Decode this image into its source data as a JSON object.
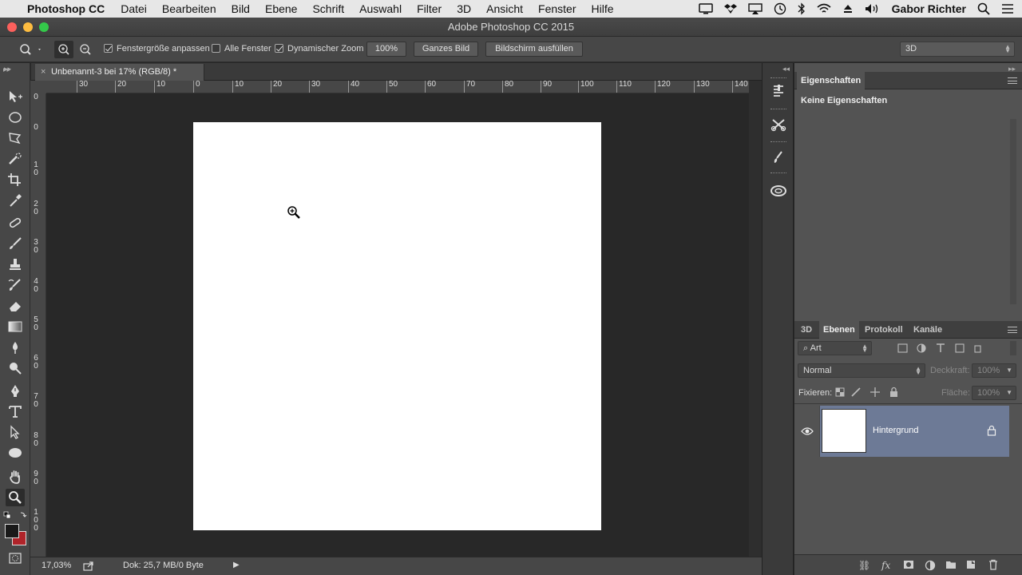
{
  "menubar": {
    "app_name": "Photoshop CC",
    "items": [
      "Datei",
      "Bearbeiten",
      "Bild",
      "Ebene",
      "Schrift",
      "Auswahl",
      "Filter",
      "3D",
      "Ansicht",
      "Fenster",
      "Hilfe"
    ],
    "user": "Gabor Richter",
    "status_icons": [
      "monitor-icon",
      "dropbox-icon",
      "airplay-icon",
      "time-machine-icon",
      "bluetooth-icon",
      "wifi-icon",
      "eject-icon",
      "volume-icon"
    ]
  },
  "window": {
    "title": "Adobe Photoshop CC 2015"
  },
  "options": {
    "fit_window": {
      "label": "Fenstergröße anpassen",
      "checked": true
    },
    "all_windows": {
      "label": "Alle Fenster",
      "checked": false
    },
    "scrubby_zoom": {
      "label": "Dynamischer Zoom",
      "checked": true
    },
    "btn_100": "100%",
    "btn_fit": "Ganzes Bild",
    "btn_fill": "Bildschirm ausfüllen",
    "workspace": "3D"
  },
  "document": {
    "tab_title": "Unbenannt-3 bei 17% (RGB/8) *",
    "close": "×",
    "h_ruler": [
      "30",
      "20",
      "10",
      "0",
      "10",
      "20",
      "30",
      "40",
      "50",
      "60",
      "70",
      "80",
      "90",
      "100",
      "110",
      "120",
      "130",
      "140"
    ],
    "v_ruler": [
      [
        "0"
      ],
      [
        "0"
      ],
      [
        "1",
        "0"
      ],
      [
        "2",
        "0"
      ],
      [
        "3",
        "0"
      ],
      [
        "4",
        "0"
      ],
      [
        "5",
        "0"
      ],
      [
        "6",
        "0"
      ],
      [
        "7",
        "0"
      ],
      [
        "8",
        "0"
      ],
      [
        "9",
        "0"
      ],
      [
        "1",
        "0",
        "0"
      ]
    ]
  },
  "status": {
    "zoom": "17,03%",
    "doc": "Dok: 25,7 MB/0 Byte"
  },
  "properties_panel": {
    "tab": "Eigenschaften",
    "content": "Keine Eigenschaften"
  },
  "layers_panel": {
    "tabs": [
      "3D",
      "Ebenen",
      "Protokoll",
      "Kanäle"
    ],
    "active_tab": "Ebenen",
    "filter": "Art",
    "blend_mode": "Normal",
    "opacity_label": "Deckkraft:",
    "opacity_value": "100%",
    "lock_label": "Fixieren:",
    "fill_label": "Fläche:",
    "fill_value": "100%",
    "layers": [
      {
        "name": "Hintergrund",
        "visible": true,
        "locked": true
      }
    ]
  },
  "colors": {
    "foreground": "#1a1a1a",
    "background": "#b0242a",
    "selection": "#6d7a96"
  }
}
